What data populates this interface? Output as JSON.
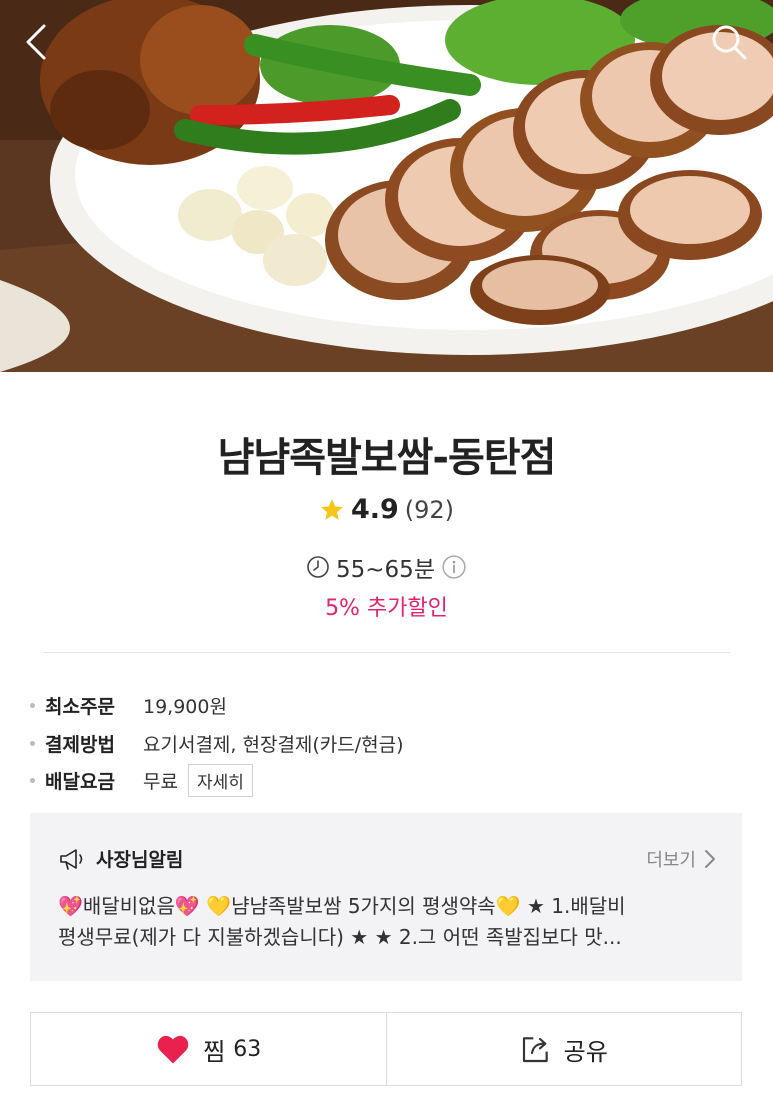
{
  "store": {
    "name": "냠냠족발보쌈-동탄점",
    "rating": "4.9",
    "review_count": "(92)",
    "delivery_time": "55~65분",
    "discount": "5% 추가할인"
  },
  "info": [
    {
      "key": "최소주문",
      "value": "19,900원"
    },
    {
      "key": "결제방법",
      "value": "요기서결제, 현장결제(카드/현금)"
    },
    {
      "key": "배달요금",
      "value": "무료",
      "button": "자세히"
    }
  ],
  "notice": {
    "title": "사장님알림",
    "more": "더보기",
    "line1": "💖배달비없음💖 💛냠냠족발보쌈 5가지의 평생약속💛 ★ 1.배달비",
    "line2": "평생무료(제가 다 지불하겠습니다) ★ ★ 2.그 어떤 족발집보다 맛..."
  },
  "actions": {
    "like_label": "찜",
    "like_count": "63",
    "share_label": "공유"
  },
  "colors": {
    "accent_pink": "#e0246e",
    "star_yellow": "#f5c518",
    "heart_red": "#e8214f"
  },
  "icons": [
    "back-arrow-icon",
    "search-icon",
    "star-icon",
    "clock-icon",
    "info-icon",
    "megaphone-icon",
    "chevron-right-icon",
    "heart-icon",
    "share-icon"
  ]
}
